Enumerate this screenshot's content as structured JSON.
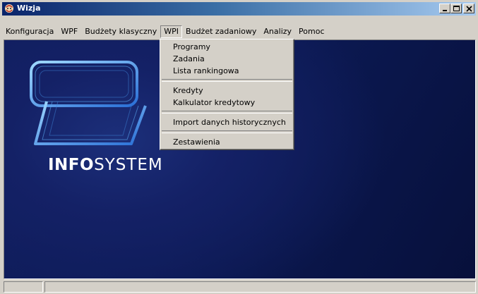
{
  "window": {
    "title": "Wizja"
  },
  "menu": {
    "items": [
      {
        "label": "Konfiguracja"
      },
      {
        "label": "WPF"
      },
      {
        "label": "Budżety klasyczny"
      },
      {
        "label": "WPI"
      },
      {
        "label": "Budżet zadaniowy"
      },
      {
        "label": "Analizy"
      },
      {
        "label": "Pomoc"
      }
    ],
    "open_item": "WPI"
  },
  "dropdown": {
    "groups": [
      [
        "Programy",
        "Zadania",
        "Lista rankingowa"
      ],
      [
        "Kredyty",
        "Kalkulator kredytowy"
      ],
      [
        "Import danych historycznych"
      ],
      [
        "Zestawienia"
      ]
    ]
  },
  "brand": {
    "bold": "INFO",
    "light": "SYSTEM"
  },
  "icons": {
    "app": "app-icon",
    "minimize": "minimize-icon",
    "maximize": "maximize-icon",
    "close": "close-icon"
  },
  "colors": {
    "titlebar_start": "#0a246a",
    "titlebar_end": "#a6caf0",
    "client_bg": "#0c1a55",
    "chrome": "#d4d0c8"
  }
}
